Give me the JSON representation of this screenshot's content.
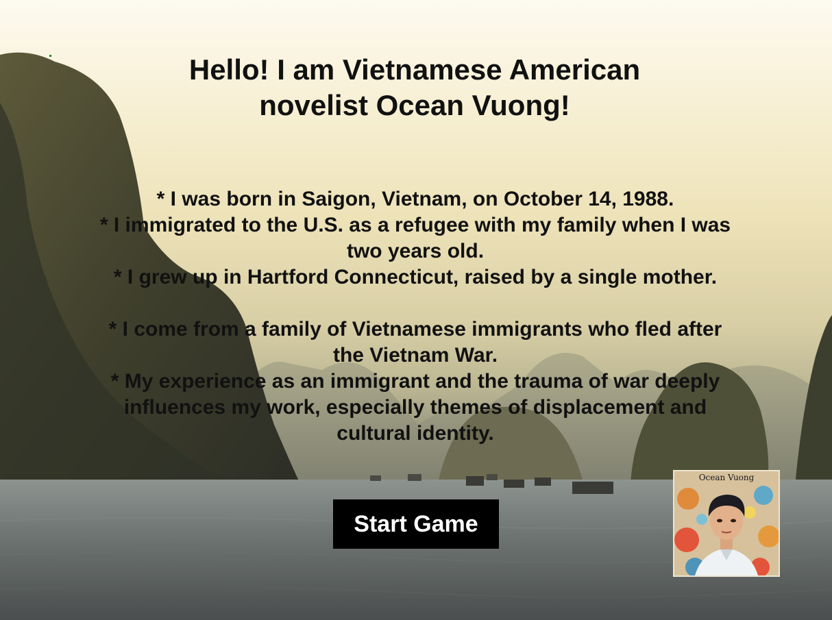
{
  "header": {
    "title_line1": "Hello! I am Vietnamese American",
    "title_line2": "novelist Ocean Vuong!"
  },
  "bio": {
    "lines": [
      "* I was born in Saigon, Vietnam, on October 14, 1988.",
      "* I immigrated to the U.S. as a refugee with my family when I was",
      "two years old.",
      "* I grew up in Hartford Connecticut, raised by a single mother.",
      "* I come from a family of Vietnamese immigrants who fled after",
      "the Vietnam War.",
      "* My experience as an immigrant and the trauma of war deeply",
      "influences my work, especially themes of displacement and",
      "cultural identity."
    ]
  },
  "start_button": {
    "label": "Start Game"
  },
  "portrait": {
    "label": "Ocean Vuong"
  },
  "colors": {
    "button_bg": "#000000",
    "button_text": "#ffffff",
    "text": "#111111"
  }
}
